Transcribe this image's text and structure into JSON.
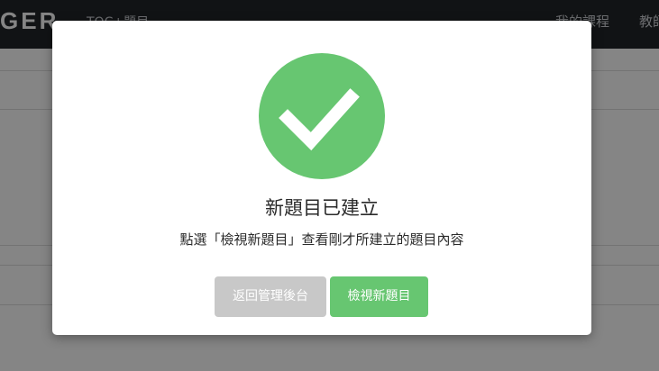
{
  "navbar": {
    "logo": "GER",
    "title": "TQC+題目",
    "links": [
      "我的課程",
      "教師"
    ]
  },
  "modal": {
    "icon": "check-circle-icon",
    "title": "新題目已建立",
    "message": "點選「檢視新題目」查看剛才所建立的題目內容",
    "buttons": {
      "back_label": "返回管理後台",
      "view_label": "檢視新題目"
    }
  },
  "colors": {
    "success": "#67c671",
    "secondary_button": "#c8c8c8",
    "navbar": "#212529"
  }
}
